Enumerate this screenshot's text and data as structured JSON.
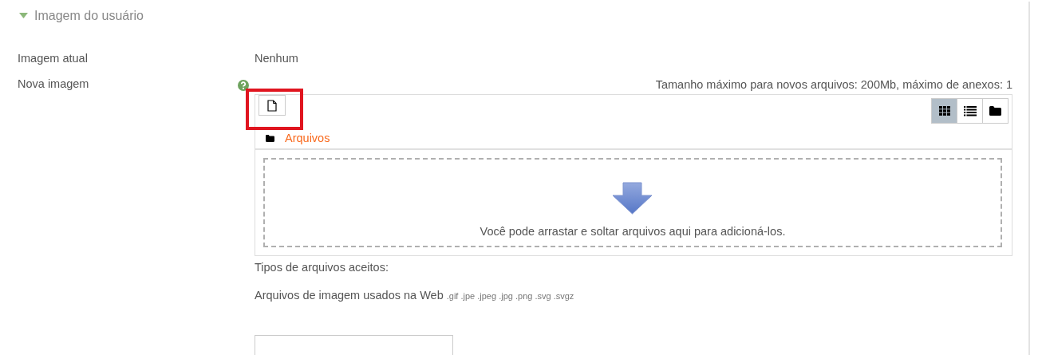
{
  "section": {
    "title": "Imagem do usuário",
    "expanded": true
  },
  "current_image": {
    "label": "Imagem atual",
    "value": "Nenhum"
  },
  "new_image": {
    "label": "Nova imagem",
    "limits": "Tamanho máximo para novos arquivos: 200Mb, máximo de anexos: 1",
    "add_button": {
      "highlighted": true
    },
    "views": [
      {
        "kind": "grid",
        "selected": true
      },
      {
        "kind": "list",
        "selected": false
      },
      {
        "kind": "tree",
        "selected": false
      }
    ],
    "path": "Arquivos",
    "dropzone": "Você pode arrastar e soltar arquivos aqui para adicioná-los.",
    "accepted_title": "Tipos de arquivos aceitos:",
    "accepted_name": "Arquivos de imagem usados na Web",
    "accepted_ext": ".gif .jpe .jpeg .jpg .png .svg .svgz"
  }
}
